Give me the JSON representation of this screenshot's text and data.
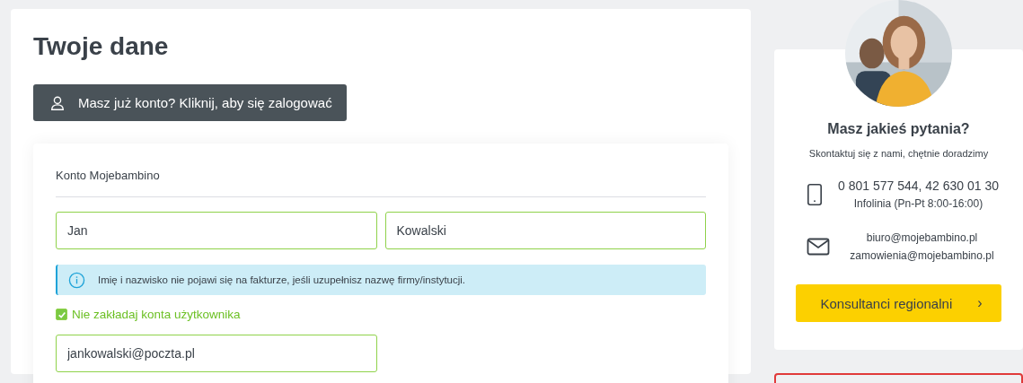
{
  "main": {
    "title": "Twoje dane",
    "login_button": "Masz już konto? Kliknij, aby się zalogować",
    "form": {
      "section_title": "Konto Mojebambino",
      "first_name": {
        "value": "Jan"
      },
      "last_name": {
        "value": "Kowalski"
      },
      "info": "Imię i nazwisko nie pojawi się na fakturze, jeśli uzupełnisz nazwę firmy/instytucji.",
      "no_account": {
        "label": "Nie zakładaj konta użytkownika",
        "checked": true
      },
      "email": {
        "value": "jankowalski@poczta.pl"
      }
    }
  },
  "contact": {
    "title": "Masz jakieś pytania?",
    "subtitle": "Skontaktuj się z nami, chętnie doradzimy",
    "items": [
      {
        "kind": "phone",
        "lines": [
          "0 801 577 544, 42 630 01 30",
          "Infolinia (Pn-Pt 8:00-16:00)"
        ]
      },
      {
        "kind": "mail",
        "lines": [
          "biuro@mojebambino.pl",
          "zamowienia@mojebambino.pl"
        ]
      }
    ],
    "button": "Konsultanci regionalni",
    "button_arrow": "›"
  }
}
